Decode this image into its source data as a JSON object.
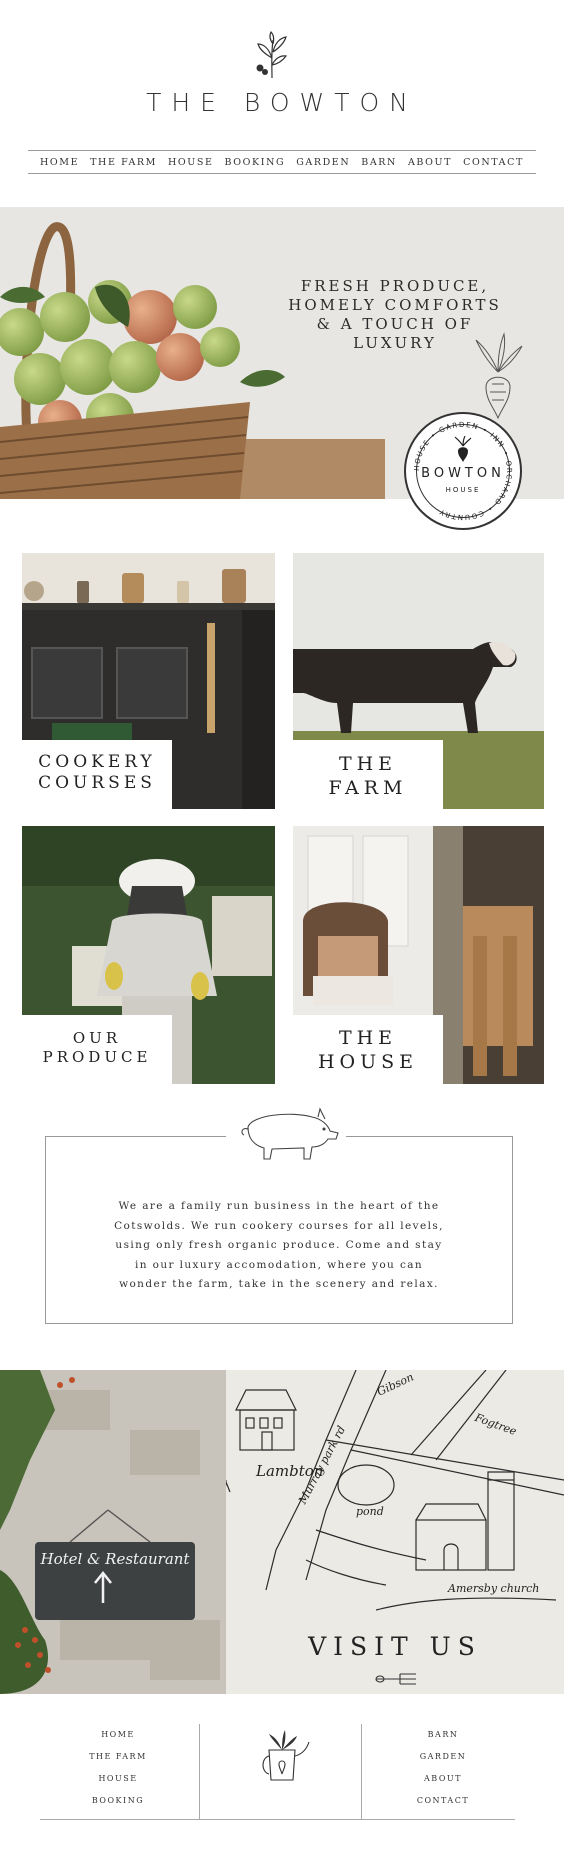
{
  "site": {
    "title": "THE BOWTON"
  },
  "nav": [
    "HOME",
    "THE FARM",
    "HOUSE",
    "BOOKING",
    "GARDEN",
    "BARN",
    "ABOUT",
    "CONTACT"
  ],
  "hero": {
    "tagline": [
      "FRESH PRODUCE,",
      "HOMELY COMFORTS",
      "& A TOUCH OF",
      "LUXURY"
    ]
  },
  "stamp": {
    "ring_text": "HOUSE • GARDEN • INN • ORCHARD • COUNTRY",
    "name": "BOWTON",
    "sub": "HOUSE"
  },
  "tiles": [
    {
      "line1": "COOKERY",
      "line2": "COURSES"
    },
    {
      "line1": "THE",
      "line2": "FARM"
    },
    {
      "line1": "OUR",
      "line2": "PRODUCE"
    },
    {
      "line1": "THE",
      "line2": "HOUSE"
    }
  ],
  "about": {
    "lines": [
      "We are a family run business in the heart of the",
      "Cotswolds. We run cookery courses for all levels,",
      "using only fresh organic produce. Come and stay",
      "in our luxury accomodation, where you can",
      "wonder the farm, take in the scenery and relax."
    ]
  },
  "visit": {
    "sign": "Hotel & Restaurant",
    "map_labels": [
      "Lambton",
      "Murray park rd",
      "Gibson",
      "Fogtree",
      "pond",
      "Amersby church"
    ],
    "title": "VISIT US"
  },
  "footer": {
    "left": [
      "HOME",
      "THE FARM",
      "HOUSE",
      "BOOKING"
    ],
    "right": [
      "BARN",
      "GARDEN",
      "ABOUT",
      "CONTACT"
    ]
  },
  "colors": {
    "background": "#ffffff",
    "text": "#2b2b2b",
    "hero_bg": "#e7e6e2",
    "map_bg": "#eceae4"
  },
  "icons": [
    "sprig-icon",
    "beet-icon",
    "pig-icon",
    "fork-icon",
    "watering-can-icon"
  ]
}
